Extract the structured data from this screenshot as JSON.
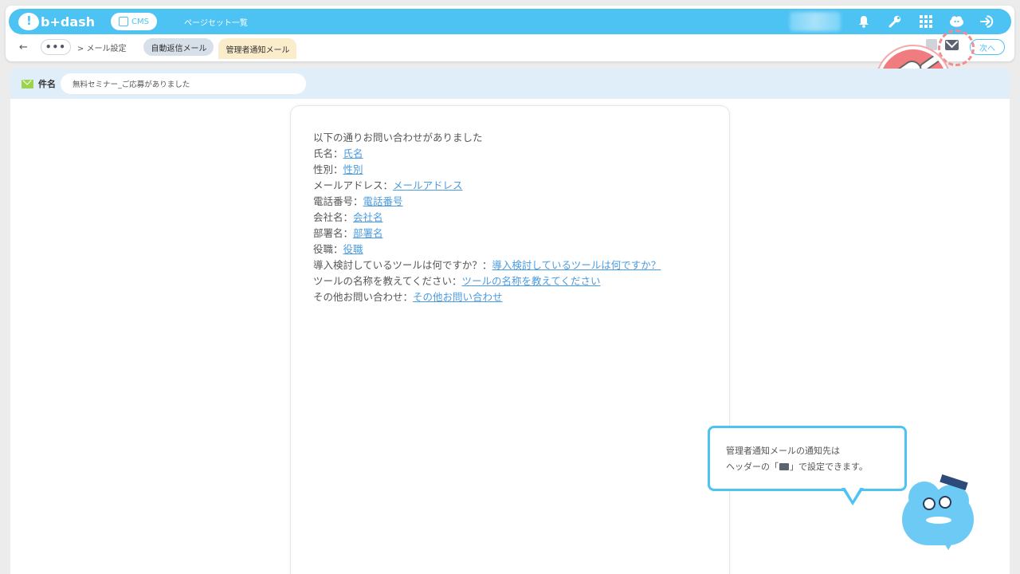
{
  "header": {
    "brand": "b+dash",
    "cms_label": "CMS",
    "page_link": "ページセット一覧",
    "icons": [
      "bell-icon",
      "wrench-icon",
      "apps-grid-icon",
      "notification-cloud-icon",
      "logout-icon"
    ]
  },
  "breadcrumb": {
    "back": "←",
    "more": "•••",
    "path": "> メール設定",
    "tabs": [
      {
        "label": "自動返信メール",
        "active": false
      },
      {
        "label": "管理者通知メール",
        "active": true
      }
    ],
    "next_label": "次へ"
  },
  "subject": {
    "label": "件名",
    "value": "無料セミナー_ご応募がありました"
  },
  "mail": {
    "intro": "以下の通りお問い合わせがありました",
    "fields": [
      {
        "label": "氏名：",
        "link": "氏名"
      },
      {
        "label": "性別：",
        "link": "性別"
      },
      {
        "label": "メールアドレス：",
        "link": "メールアドレス"
      },
      {
        "label": "電話番号：",
        "link": "電話番号"
      },
      {
        "label": "会社名：",
        "link": "会社名"
      },
      {
        "label": "部署名：",
        "link": "部署名"
      },
      {
        "label": "役職：",
        "link": "役職"
      },
      {
        "label": "導入検討しているツールは何ですか？：",
        "link": "導入検討しているツールは何ですか？"
      },
      {
        "label": "ツールの名称を教えてください：",
        "link": "ツールの名称を教えてください"
      },
      {
        "label": "その他お問い合わせ：",
        "link": "その他お問い合わせ"
      }
    ]
  },
  "tooltip": {
    "line1": "管理者通知メールの通知先は",
    "line2_prefix": "ヘッダーの「",
    "line2_suffix": "」で設定できます。"
  },
  "colors": {
    "accent": "#4cc3f3",
    "highlight": "#f07c80",
    "link": "#4a9be0"
  }
}
